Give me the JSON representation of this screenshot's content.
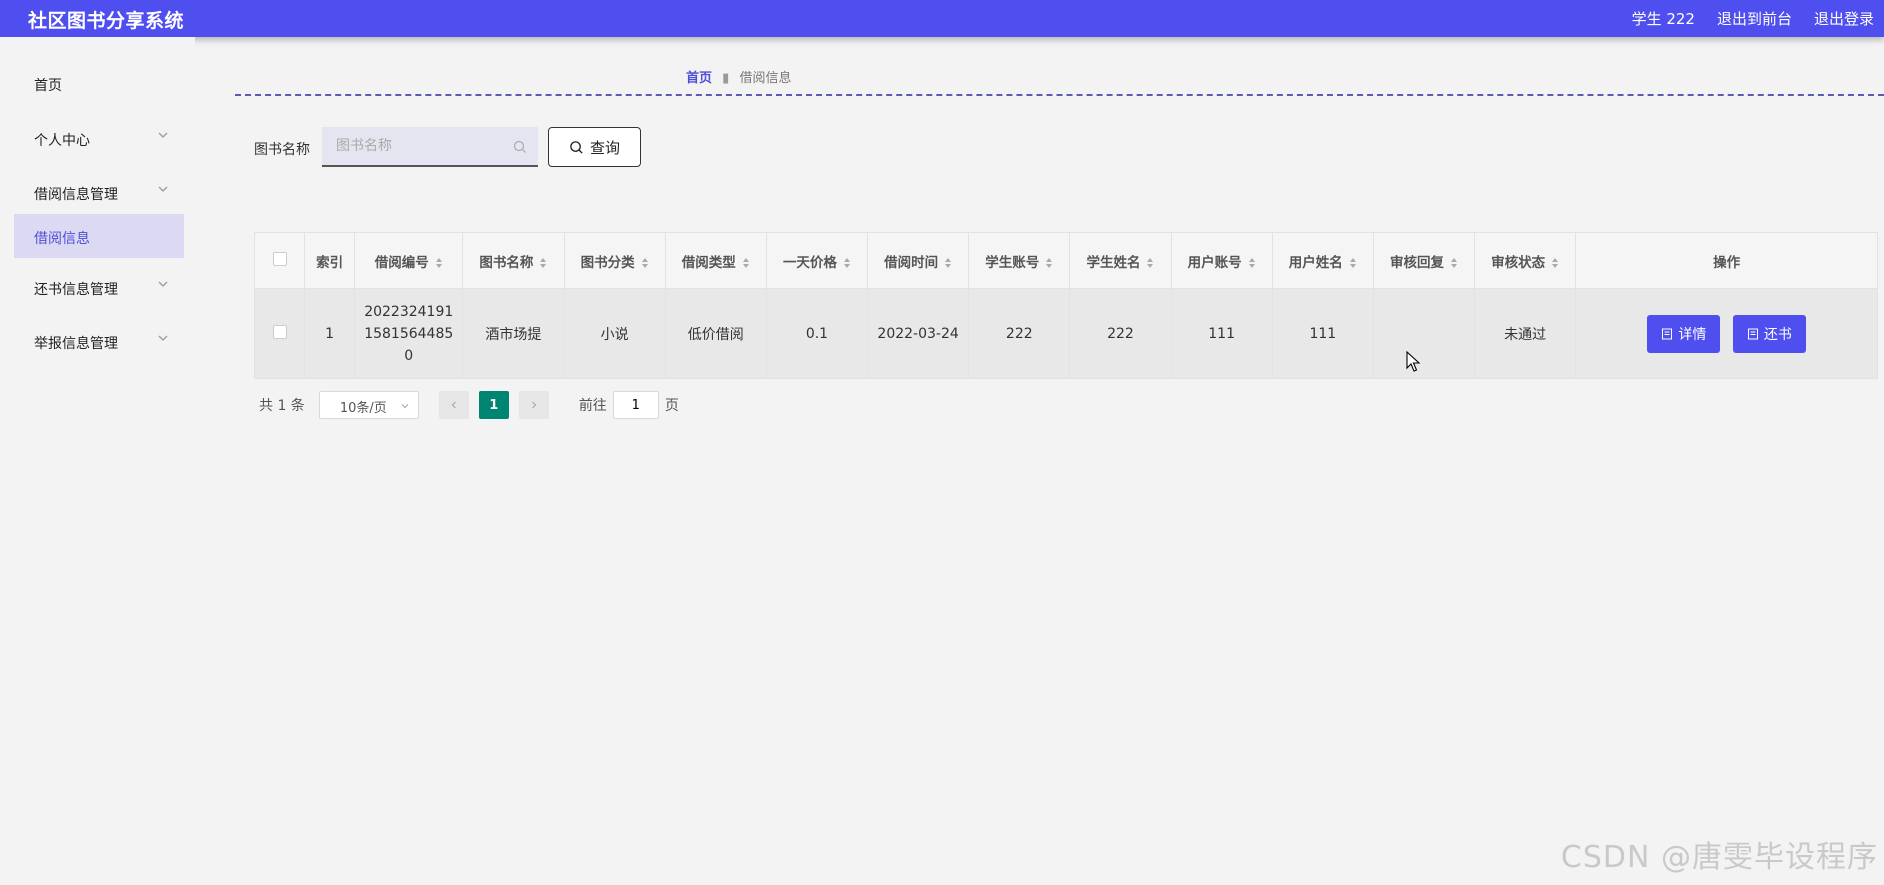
{
  "header": {
    "title": "社区图书分享系统",
    "user": "学生 222",
    "to_front": "退出到前台",
    "logout": "退出登录"
  },
  "sidebar": {
    "items": [
      {
        "label": "首页"
      },
      {
        "label": "个人中心"
      },
      {
        "label": "借阅信息管理"
      },
      {
        "label": "借阅信息"
      },
      {
        "label": "还书信息管理"
      },
      {
        "label": "举报信息管理"
      }
    ]
  },
  "breadcrumb": {
    "home": "首页",
    "current": "借阅信息"
  },
  "search": {
    "label": "图书名称",
    "placeholder": "图书名称",
    "button": "查询"
  },
  "table": {
    "headers": [
      "索引",
      "借阅编号",
      "图书名称",
      "图书分类",
      "借阅类型",
      "一天价格",
      "借阅时间",
      "学生账号",
      "学生姓名",
      "用户账号",
      "用户姓名",
      "审核回复",
      "审核状态",
      "操作"
    ],
    "rows": [
      {
        "index": "1",
        "borrow_no_1": "2022324191",
        "borrow_no_2": "1581564485",
        "borrow_no_3": "0",
        "book_name": "酒市场提",
        "category": "小说",
        "borrow_type": "低价借阅",
        "daily_price": "0.1",
        "borrow_time": "2022-03-24",
        "student_account": "222",
        "student_name": "222",
        "user_account": "111",
        "user_name": "111",
        "review_reply": "",
        "review_status": "未通过"
      }
    ],
    "actions": {
      "detail": "详情",
      "return": "还书"
    }
  },
  "pagination": {
    "total": "共 1 条",
    "page_size": "10条/页",
    "current_page": "1",
    "goto_prefix": "前往",
    "goto_value": "1",
    "goto_suffix": "页"
  },
  "watermark": "CSDN @唐雯毕设程序",
  "colors": {
    "primary": "#4f4fef",
    "active_page": "#008573",
    "sidebar_active_bg": "#dcd9f2"
  }
}
